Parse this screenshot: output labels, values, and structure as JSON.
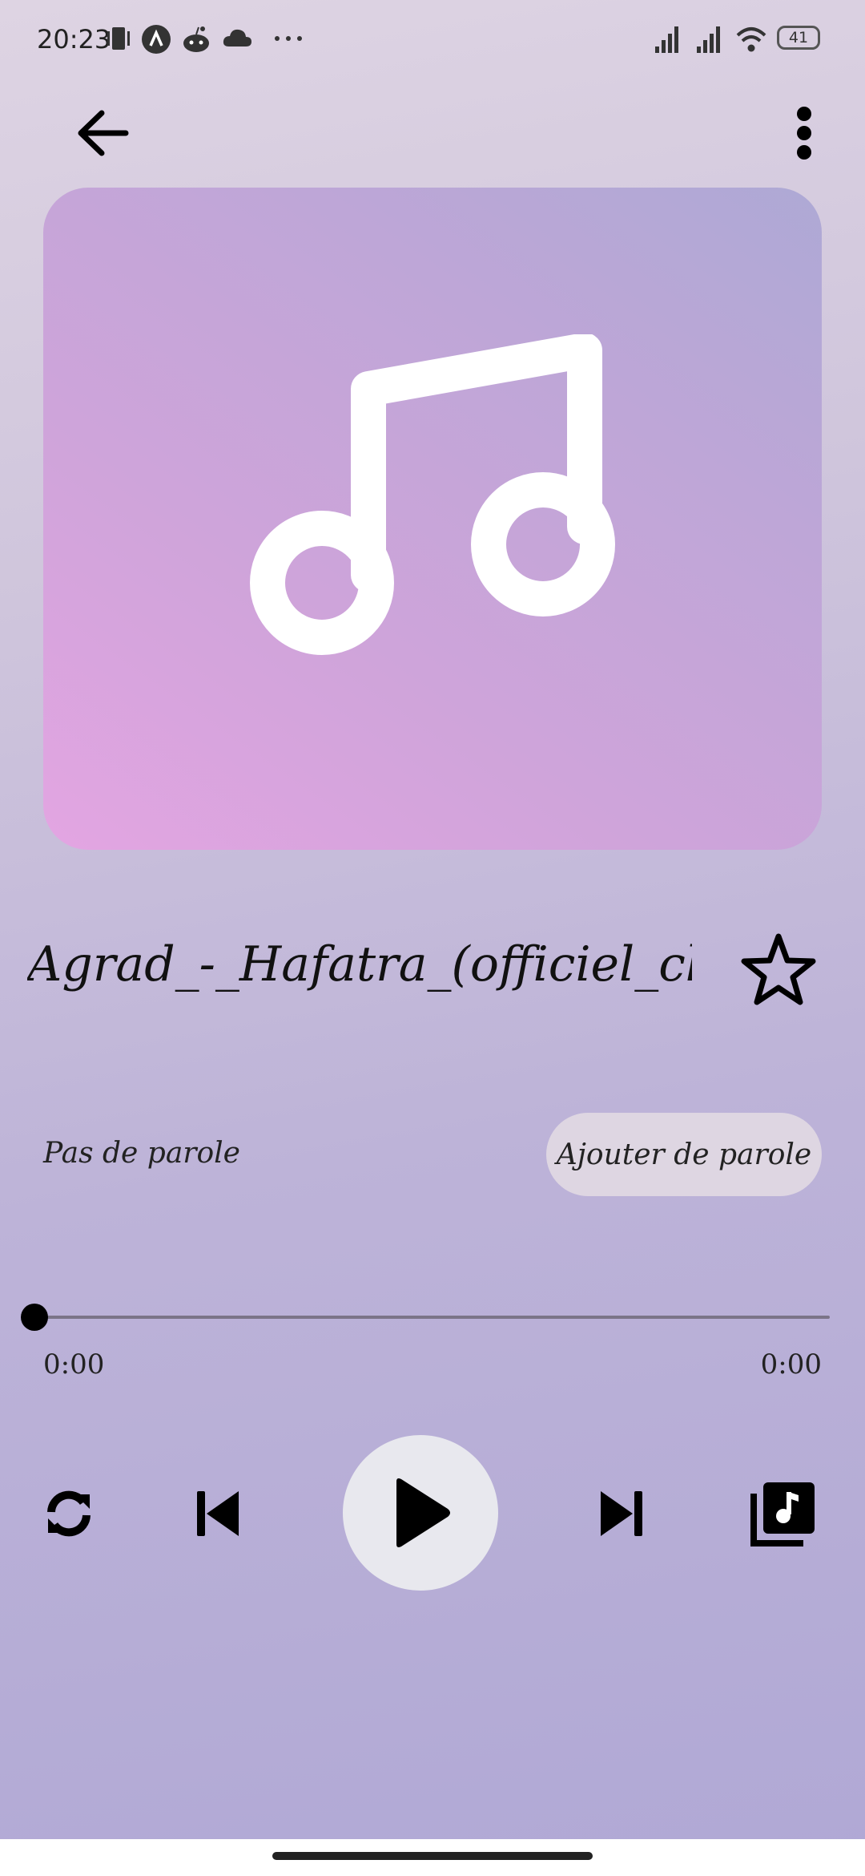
{
  "status_bar": {
    "time": "20:23",
    "battery": "41"
  },
  "app_bar": {
    "back_icon": "arrow-left-icon",
    "more_icon": "more-vertical-icon"
  },
  "artwork": {
    "icon": "music-note-icon"
  },
  "track": {
    "title": "Agrad_-_Hafatra_(officiel_clip",
    "favorite_icon": "star-outline-icon"
  },
  "lyrics": {
    "status": "Pas de parole",
    "add_button": "Ajouter de parole"
  },
  "player": {
    "current_time": "0:00",
    "total_time": "0:00",
    "progress": 0,
    "controls": {
      "repeat_icon": "repeat-icon",
      "previous_icon": "skip-previous-icon",
      "play_icon": "play-icon",
      "next_icon": "skip-next-icon",
      "queue_icon": "music-library-icon"
    }
  },
  "colors": {
    "accent_button": "#e8e8ee",
    "artwork_start": "#e3a5e2",
    "artwork_end": "#aea9d5"
  }
}
